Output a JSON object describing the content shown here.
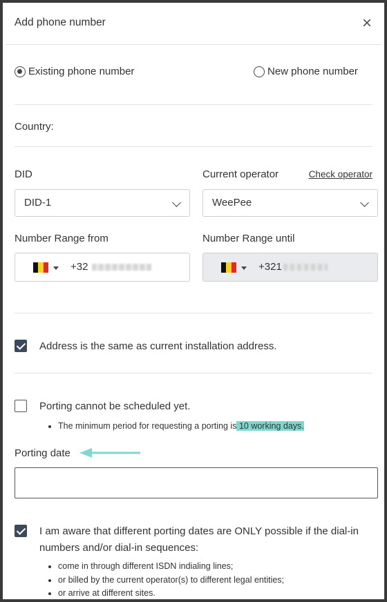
{
  "dialog": {
    "title": "Add phone number",
    "close_symbol": "×"
  },
  "number_type": {
    "existing_label": "Existing phone number",
    "new_label": "New phone number",
    "selected": "existing"
  },
  "country": {
    "label": "Country:"
  },
  "did": {
    "label": "DID",
    "value": "DID-1"
  },
  "operator": {
    "label": "Current operator",
    "check_link": "Check operator",
    "value": "WeePee"
  },
  "range_from": {
    "label": "Number Range from",
    "prefix": "+32"
  },
  "range_until": {
    "label": "Number Range until",
    "prefix": "+321"
  },
  "address": {
    "label": "Address is the same as current installation address.",
    "checked": true
  },
  "porting_unscheduled": {
    "label": "Porting cannot be scheduled yet.",
    "checked": false,
    "note_prefix": "The minimum period for requesting a porting is",
    "note_highlight": " 10 working days."
  },
  "porting_date": {
    "label": "Porting date",
    "value": ""
  },
  "awareness": {
    "checked": true,
    "text": "I am aware that different porting dates are ONLY possible if the dial-in numbers and/or dial-in sequences:",
    "items": [
      "come in through different ISDN indialing lines;",
      "or billed by the current operator(s) to different legal entities;",
      "or arrive at different sites."
    ]
  },
  "colors": {
    "checkbox": "#3b4a5b",
    "highlight": "#7fd8d0",
    "arrow": "#7fd8d0"
  },
  "icons": {
    "flag": "belgium-flag-icon",
    "close": "close-icon"
  }
}
